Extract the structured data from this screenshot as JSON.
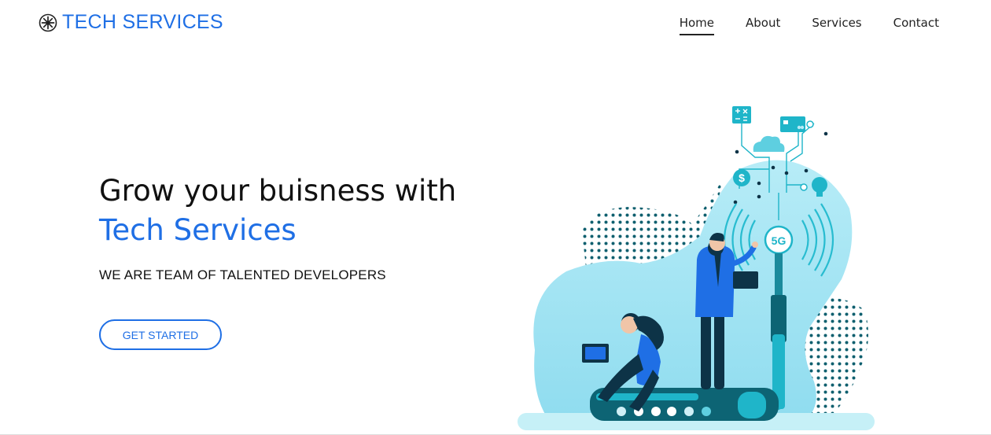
{
  "brand": {
    "name": "TECH SERVICES",
    "icon": "asterisk-circle-icon",
    "color": "#1f6fe5"
  },
  "nav": {
    "items": [
      {
        "label": "Home",
        "active": true
      },
      {
        "label": "About",
        "active": false
      },
      {
        "label": "Services",
        "active": false
      },
      {
        "label": "Contact",
        "active": false
      }
    ]
  },
  "hero": {
    "headline": "Grow your buisness with",
    "headline_accent": "Tech Services",
    "tagline": "WE ARE TEAM OF TALENTED DEVELOPERS",
    "cta_label": "GET STARTED",
    "illustration": {
      "badge": "5G",
      "currency_symbol": "$"
    }
  },
  "colors": {
    "accent": "#1f6fe5",
    "text": "#111111",
    "illustration_light": "#9fe3f2",
    "illustration_teal": "#1fb5c9",
    "illustration_dark": "#0d4f63"
  }
}
